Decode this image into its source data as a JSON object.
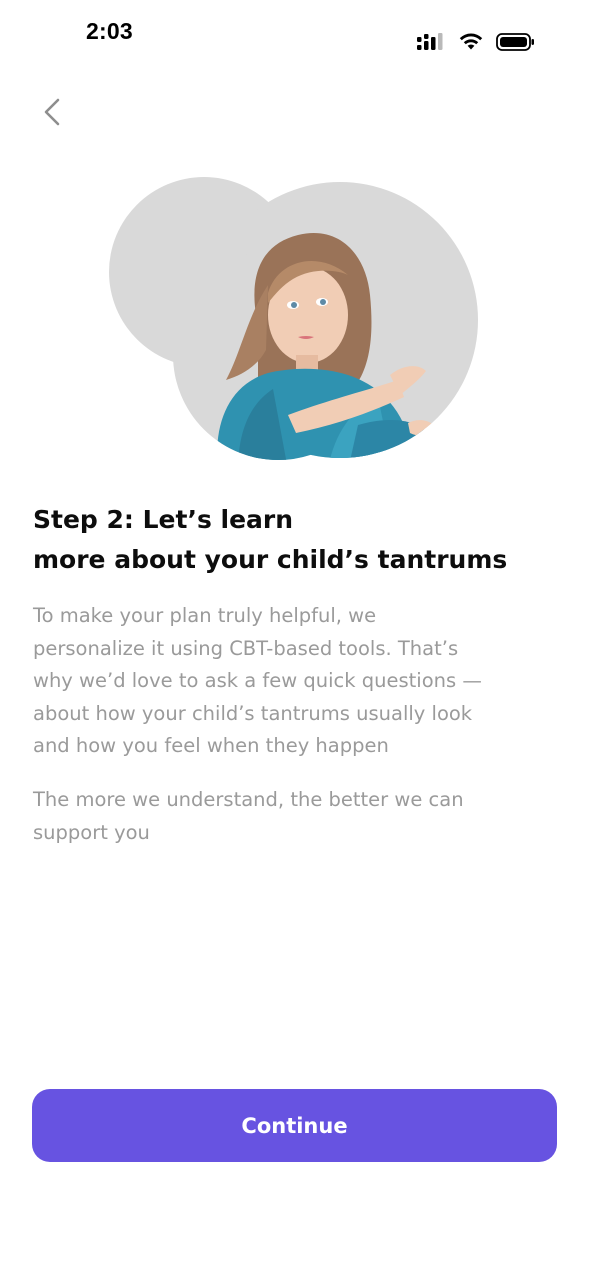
{
  "status_bar": {
    "time": "2:03",
    "icons": [
      "signal-icon",
      "wifi-icon",
      "battery-icon"
    ]
  },
  "navigation": {
    "back_icon": "chevron-left-icon"
  },
  "illustration": {
    "subject": "child-photo"
  },
  "heading": {
    "line_1": "Step 2: Let’s learn",
    "line_2": "more about your child’s tantrums"
  },
  "body": {
    "paragraph_1": [
      "To make your plan truly helpful, we",
      "personalize it using CBT-based tools. That’s",
      "why we’d love to ask a few quick questions —",
      "about how your child’s tantrums usually look",
      "and how you feel when they happen"
    ],
    "paragraph_2": [
      "The more we understand, the better we can",
      "support you"
    ]
  },
  "actions": {
    "continue_label": "Continue"
  },
  "colors": {
    "accent": "#6753e1",
    "heading_text": "#0d0d0d",
    "body_text": "#9a9a9a",
    "blob": "#d9d9d9",
    "background": "#ffffff"
  }
}
